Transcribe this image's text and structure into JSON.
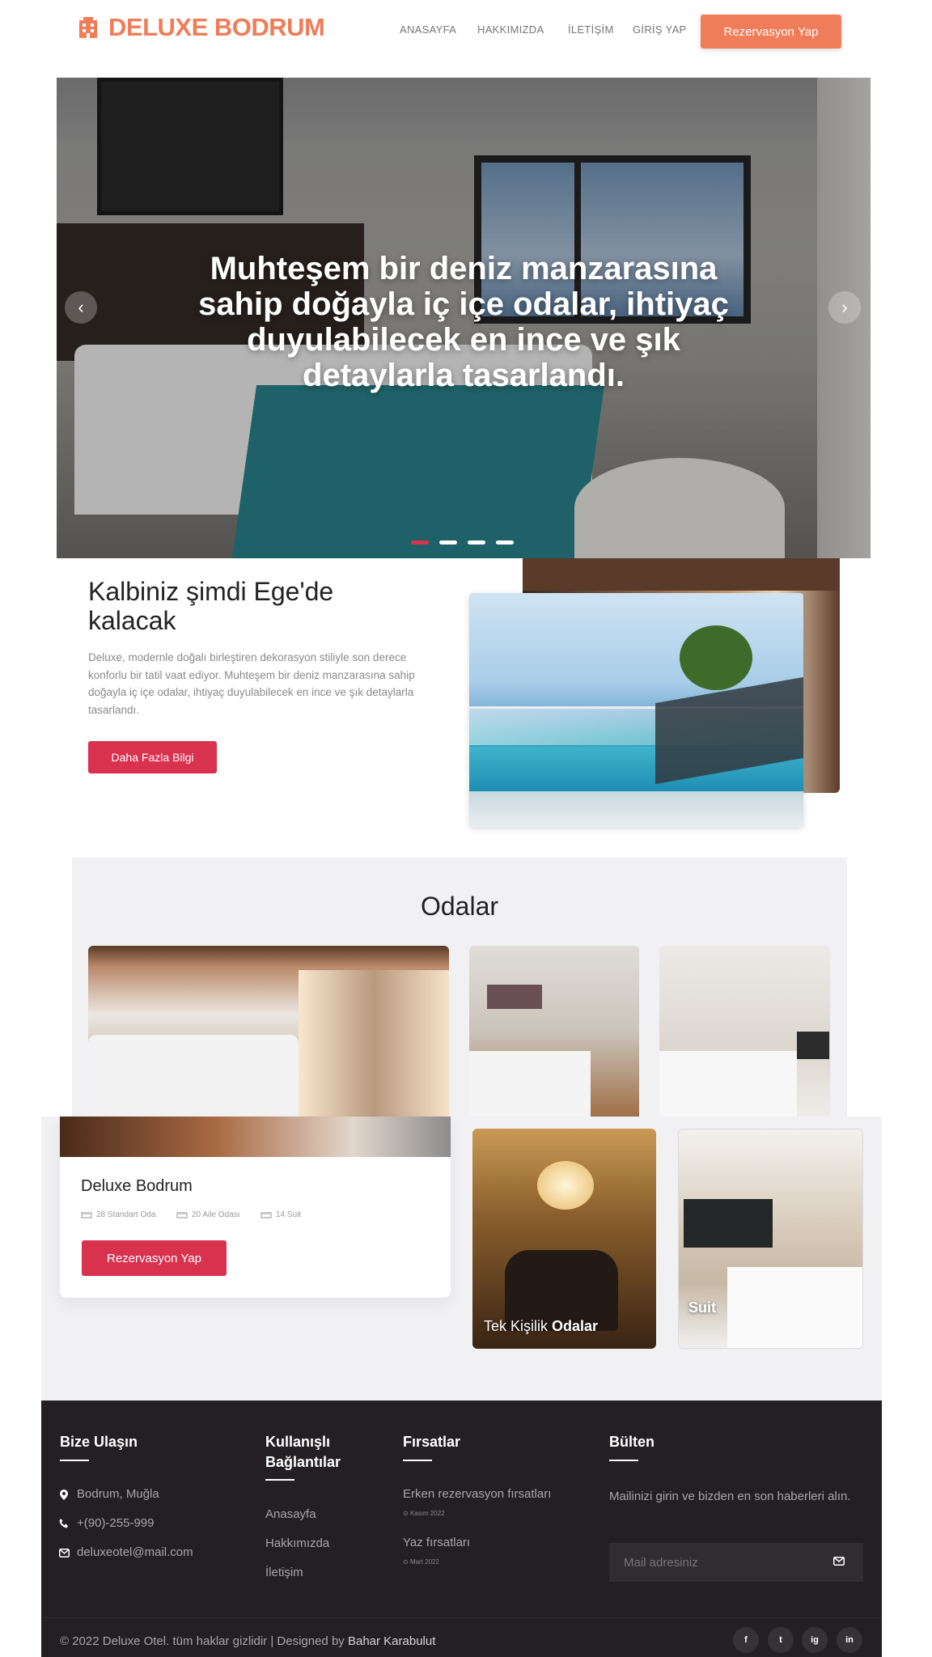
{
  "brand": {
    "name": "DELUXE BODRUM",
    "accent": "#ef7d5a"
  },
  "nav": {
    "items": [
      {
        "label": "ANASAYFA"
      },
      {
        "label": "HAKKIMIZDA"
      },
      {
        "label": "İLETİŞİM"
      },
      {
        "label": "GİRİŞ YAP"
      }
    ],
    "cta": "Rezervasyon Yap"
  },
  "hero": {
    "title": "Muhteşem bir deniz manzarasına sahip doğayla iç içe odalar, ihtiyaç duyulabilecek en ince ve şık detaylarla tasarlandı.",
    "prev_icon": "chevron-left-icon",
    "next_icon": "chevron-right-icon",
    "slides_total": 4,
    "active_slide": 1,
    "indicator_active_color": "#d8324f"
  },
  "about": {
    "title": "Kalbiniz şimdi Ege'de kalacak",
    "text": "Deluxe, modernle doğalı birleştiren dekorasyon stiliyle son derece konforlu bir tatil vaat ediyor. Muhteşem bir deniz manzarasına sahip doğayla iç içe odalar, ihtiyaç duyulabilecek en ince ve şık detaylarla tasarlandı.",
    "button": "Daha Fazla Bilgi",
    "button_color": "#d8324f"
  },
  "rooms": {
    "title": "Odalar",
    "card": {
      "name": "Deluxe Bodrum",
      "features": [
        "28 Standart Oda",
        "20 Aile Odası",
        "14 Suit"
      ],
      "button": "Rezervasyon Yap"
    },
    "tiles": [
      {
        "label_regular": "Tek Kişilik",
        "label_bold": "Odalar"
      },
      {
        "label_regular": "",
        "label_bold": "Suit"
      }
    ]
  },
  "footer": {
    "contact": {
      "title": "Bize Ulaşın",
      "address": "Bodrum, Muğla",
      "phone": "+(90)-255-999",
      "email": "deluxeotel@mail.com"
    },
    "links": {
      "title": "Kullanışlı Bağlantılar",
      "items": [
        "Anasayfa",
        "Hakkımızda",
        "İletişim"
      ]
    },
    "deals": {
      "title": "Fırsatlar",
      "items": [
        {
          "name": "Erken rezervasyon fırsatları",
          "date": "Kasım 2022"
        },
        {
          "name": "Yaz fırsatları",
          "date": "Mart 2022"
        }
      ]
    },
    "newsletter": {
      "title": "Bülten",
      "text": "Mailinizi girin ve bizden en son haberleri alın.",
      "placeholder": "Mail adresiniz"
    },
    "copyright": "© 2022 Deluxe Otel. tüm haklar gizlidir | Designed by",
    "designer": "Bahar Karabulut",
    "social": [
      "f",
      "t",
      "ig",
      "in"
    ],
    "background": "#231f22"
  }
}
